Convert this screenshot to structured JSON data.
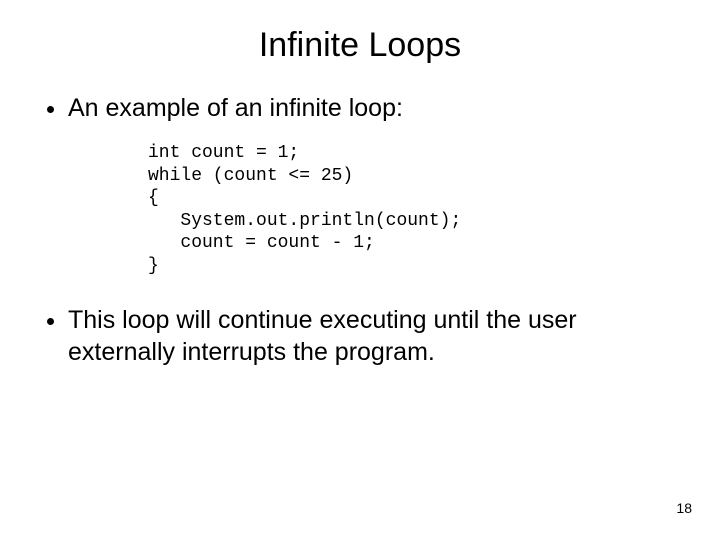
{
  "slide": {
    "title": "Infinite Loops",
    "bullet1": "An example of an infinite loop:",
    "code": "int count = 1;\nwhile (count <= 25)\n{\n   System.out.println(count);\n   count = count - 1;\n}",
    "bullet2": "This loop will continue executing until the user externally interrupts the program.",
    "page_number": "18"
  }
}
